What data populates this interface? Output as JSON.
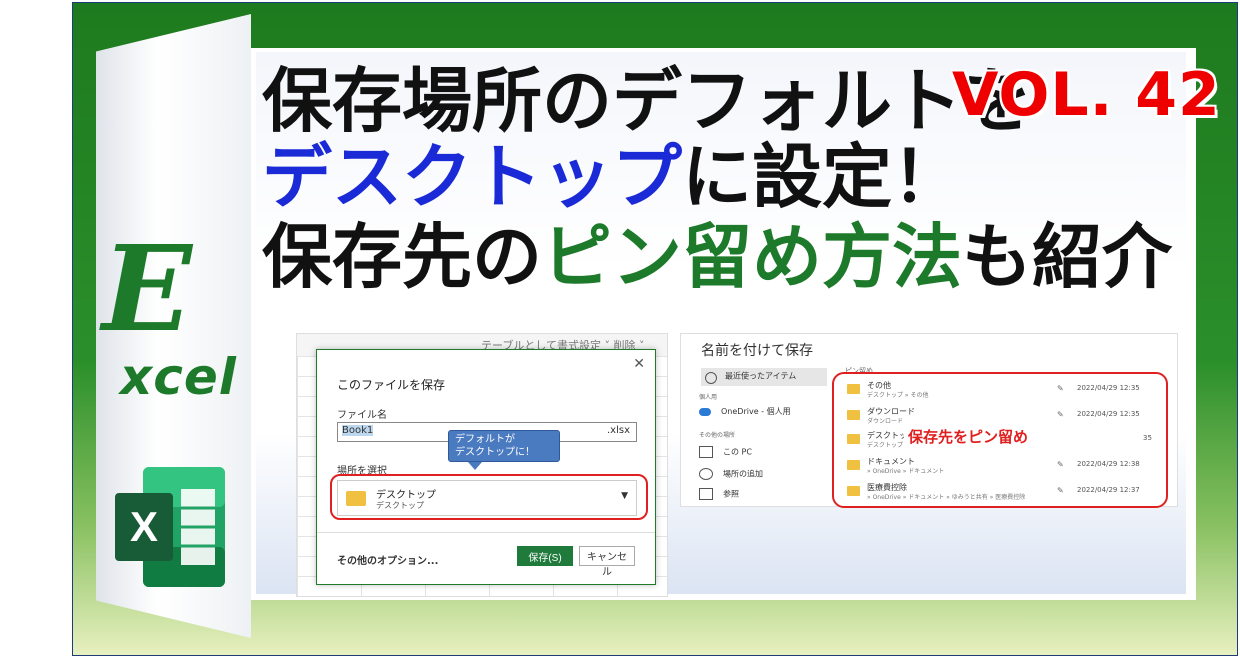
{
  "title": {
    "line1": "保存場所のデフォルトを",
    "vol": "VOL. 42",
    "line2_blue": "デスクトップ",
    "line2_black": "に設定！",
    "line3_black1": "保存先の",
    "line3_green": "ピン留め方法",
    "line3_black2": "も紹介"
  },
  "cover": {
    "letter": "E",
    "word": "xcel",
    "logo_letter": "X"
  },
  "left_shot": {
    "toolbar_text": "テーブルとして書式設定 ˅   削除 ˅",
    "close": "✕",
    "dialog_title": "このファイルを保存",
    "filename_label": "ファイル名",
    "filename_value": "Book1",
    "filename_ext": ".xlsx",
    "location_label": "場所を選択",
    "location_name": "デスクトップ",
    "location_sub": "デスクトップ",
    "tooltip_line1": "デフォルトが",
    "tooltip_line2": "デスクトップに！",
    "more_options": "その他のオプション...",
    "save_button": "保存(S)",
    "cancel_button": "キャンセル"
  },
  "right_shot": {
    "title": "名前を付けて保存",
    "nav": [
      {
        "label": "最近使ったアイテム",
        "icon": "clock-icon"
      },
      {
        "label": "個人用",
        "icon": ""
      },
      {
        "label": "OneDrive - 個人用",
        "icon": "cloud-icon"
      },
      {
        "label": "その他の場所",
        "icon": ""
      },
      {
        "label": "この PC",
        "icon": "pc-icon"
      },
      {
        "label": "場所の追加",
        "icon": "globe-icon"
      },
      {
        "label": "参照",
        "icon": "folder-open-icon"
      }
    ],
    "pinned_label": "ピン留め",
    "rows": [
      {
        "name": "その他",
        "path": "デスクトップ » その他",
        "date": "2022/04/29 12:35"
      },
      {
        "name": "ダウンロード",
        "path": "ダウンロード",
        "date": "2022/04/29 12:35"
      },
      {
        "name": "デスクトップ",
        "path": "デスクトップ",
        "date": "35"
      },
      {
        "name": "ドキュメント",
        "path": "» OneDrive » ドキュメント",
        "date": "2022/04/29 12:38"
      },
      {
        "name": "医療費控除",
        "path": "» OneDrive » ドキュメント » ゆみうと共有 » 医療費控除",
        "date": "2022/04/29 12:37"
      }
    ],
    "pin_annotation": "保存先をピン留め"
  },
  "colors": {
    "green": "#1d7a2a",
    "blue": "#1a2ad6",
    "red": "#ee0000"
  }
}
